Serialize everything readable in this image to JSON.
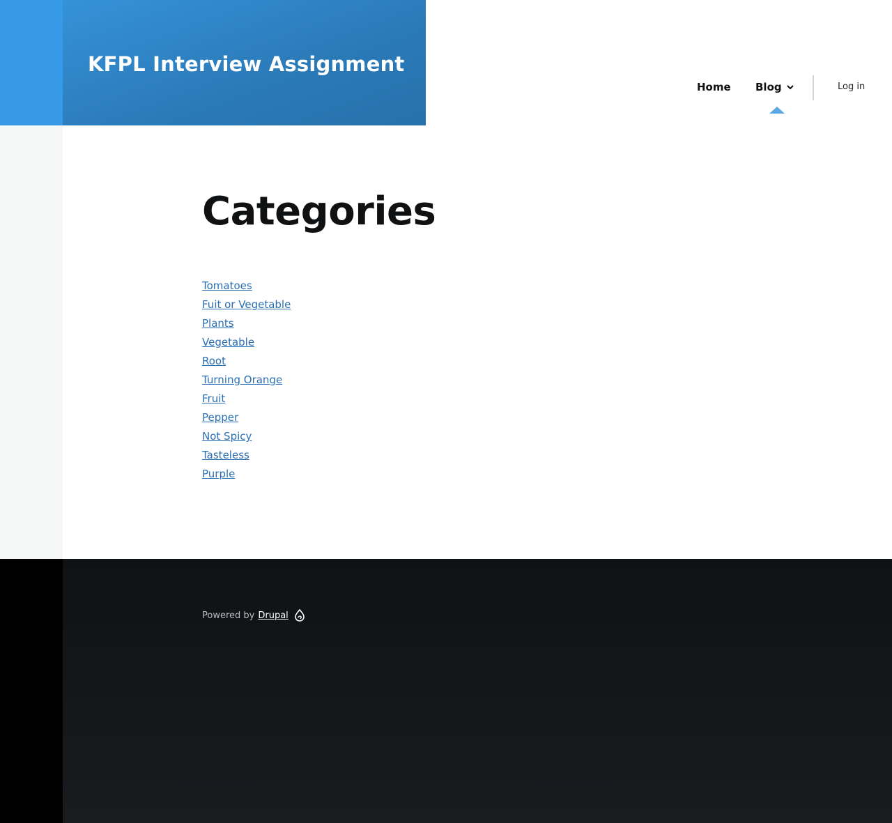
{
  "site": {
    "name": "KFPL Interview Assignment"
  },
  "nav": {
    "home": "Home",
    "blog": "Blog",
    "login": "Log in"
  },
  "page": {
    "title": "Categories"
  },
  "categories": [
    "Tomatoes",
    "Fuit or Vegetable",
    "Plants",
    "Vegetable",
    "Root",
    "Turning Orange",
    "Fruit",
    "Pepper",
    "Not Spicy",
    "Tasteless",
    "Purple"
  ],
  "footer": {
    "powered_by": "Powered by",
    "drupal": "Drupal"
  },
  "colors": {
    "brand_blue": "#2b7ab8",
    "link": "#2b6fb3",
    "footer_bg": "#0f1214"
  },
  "icons": {
    "blog_dropdown": "chevron-down-icon",
    "active_marker": "triangle-up-icon",
    "drupal_logo": "drupal-drop-icon"
  }
}
